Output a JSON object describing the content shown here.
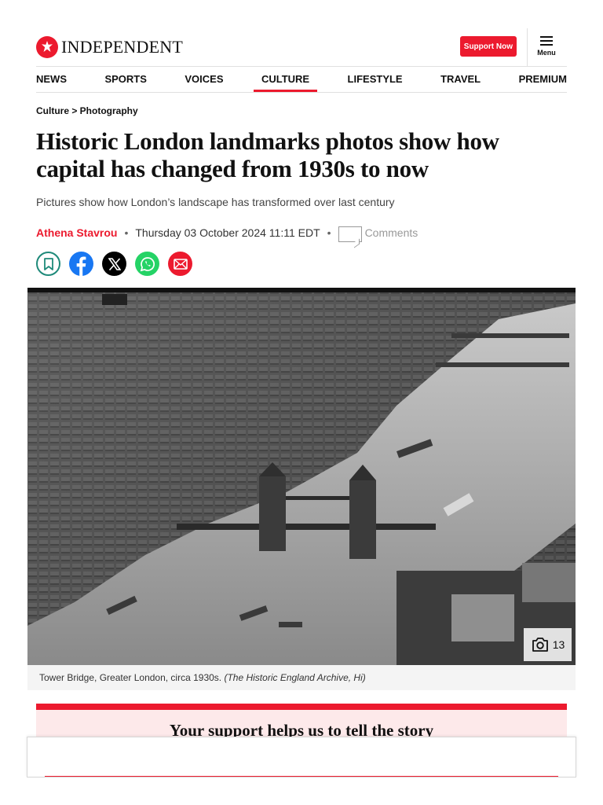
{
  "brand": {
    "name": "INDEPENDENT",
    "accent": "#ec1a2e"
  },
  "header": {
    "support_label": "Support Now",
    "menu_label": "Menu"
  },
  "nav": {
    "items": [
      "NEWS",
      "SPORTS",
      "VOICES",
      "CULTURE",
      "LIFESTYLE",
      "TRAVEL",
      "PREMIUM"
    ],
    "active": "CULTURE"
  },
  "breadcrumb": "Culture > Photography",
  "article": {
    "headline": "Historic London landmarks photos show how capital has changed from 1930s to now",
    "standfirst": "Pictures show how London’s landscape has transformed over last century",
    "author": "Athena Stavrou",
    "date": "Thursday 03 October 2024 11:11 EDT",
    "comments_label": "Comments"
  },
  "share_icons": [
    "bookmark-icon",
    "facebook-icon",
    "x-icon",
    "whatsapp-icon",
    "email-icon"
  ],
  "image": {
    "gallery_count": "13",
    "caption": "Tower Bridge, Greater London, circa 1930s. ",
    "credit": "(The Historic England Archive, Hi)"
  },
  "support_box": {
    "heading": "Your support helps us to tell the story"
  }
}
